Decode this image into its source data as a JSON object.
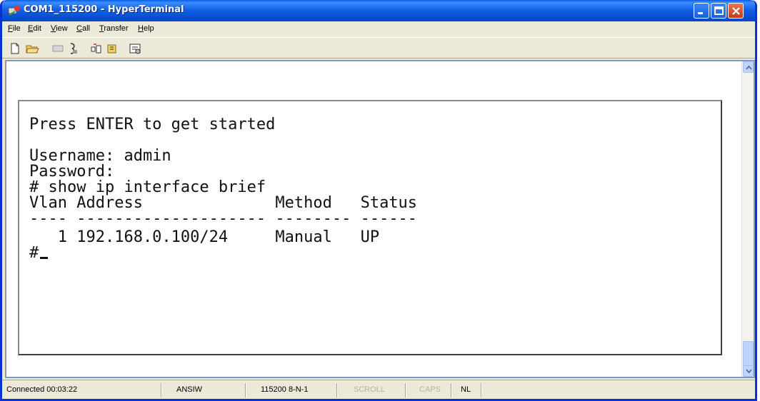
{
  "window": {
    "title": "COM1_115200 - HyperTerminal"
  },
  "menu": [
    "File",
    "Edit",
    "View",
    "Call",
    "Transfer",
    "Help"
  ],
  "toolbar_icons": [
    "new-icon",
    "open-icon",
    "disconnect-icon",
    "dial-icon",
    "send-icon",
    "receive-icon",
    "properties-icon"
  ],
  "terminal": {
    "lines": [
      "Press ENTER to get started",
      "",
      "Username: admin",
      "Password:",
      "# show ip interface brief",
      "Vlan Address              Method   Status",
      "---- -------------------- -------- ------",
      "   1 192.168.0.100/24     Manual   UP",
      "#"
    ]
  },
  "status": {
    "connected": "Connected 00:03:22",
    "emulation": "ANSIW",
    "settings": "115200 8-N-1",
    "scroll": "SCROLL",
    "caps": "CAPS",
    "num": "NL"
  }
}
